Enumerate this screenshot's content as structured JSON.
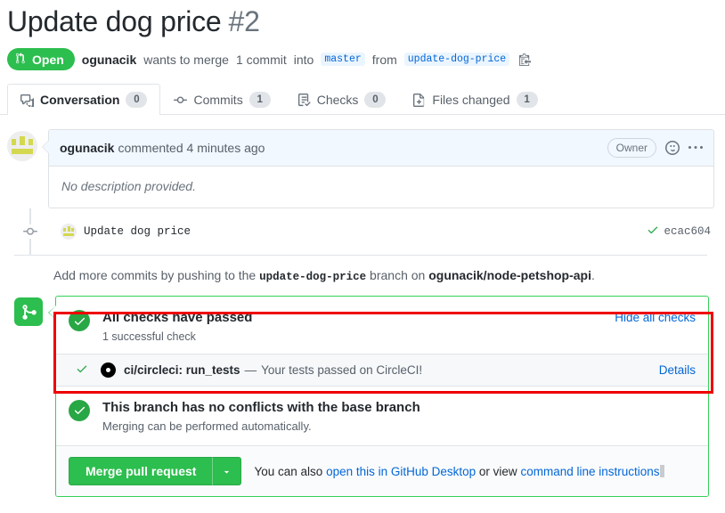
{
  "header": {
    "title": "Update dog price",
    "number": "#2",
    "state_badge": {
      "label": "Open",
      "icon": "pull-request-icon",
      "color": "#2cbe4e"
    },
    "author": "ogunacik",
    "merge_text_1": "wants to merge",
    "commit_count_text": "1 commit",
    "merge_text_2": "into",
    "base_branch": "master",
    "merge_text_3": "from",
    "head_branch": "update-dog-price",
    "copy_icon": "clipboard-copy-icon"
  },
  "tabs": [
    {
      "label": "Conversation",
      "count": "0",
      "icon": "comment-discussion-icon",
      "active": true
    },
    {
      "label": "Commits",
      "count": "1",
      "icon": "git-commit-icon",
      "active": false
    },
    {
      "label": "Checks",
      "count": "0",
      "icon": "checklist-icon",
      "active": false
    },
    {
      "label": "Files changed",
      "count": "1",
      "icon": "file-diff-icon",
      "active": false
    }
  ],
  "comment": {
    "avatar": "user-avatar-identicon",
    "author": "ogunacik",
    "action": "commented",
    "timestamp": "4 minutes ago",
    "owner_badge": "Owner",
    "reaction_icon": "smiley-icon",
    "menu_icon": "kebab-horizontal-icon",
    "body": "No description provided."
  },
  "commit": {
    "dot_icon": "git-commit-icon",
    "avatar": "user-avatar-identicon",
    "message": "Update dog price",
    "status_icon": "check-icon",
    "sha": "ecac604"
  },
  "add_more": {
    "prefix": "Add more commits by pushing to the",
    "branch": "update-dog-price",
    "middle": "branch on",
    "repo": "ogunacik/node-petshop-api",
    "suffix": "."
  },
  "merge": {
    "badge_icon": "git-merge-icon",
    "badge_color": "#2cbe4e",
    "box_border_color": "#34d058",
    "checks": {
      "status_icon": "check-circle-icon",
      "title": "All checks have passed",
      "subtitle": "1 successful check",
      "hide_link": "Hide all checks"
    },
    "check_items": [
      {
        "tick_icon": "check-icon",
        "logo_icon": "circleci-logo-icon",
        "name": "ci/circleci: run_tests",
        "separator": "—",
        "description": "Your tests passed on CircleCI!",
        "details_link": "Details"
      }
    ],
    "conflict": {
      "status_icon": "check-circle-icon",
      "title": "This branch has no conflicts with the base branch",
      "subtitle": "Merging can be performed automatically."
    },
    "actions": {
      "merge_button": "Merge pull request",
      "caret_icon": "triangle-down-icon",
      "note_prefix": "You can also",
      "desktop_link": "open this in GitHub Desktop",
      "note_middle": "or view",
      "cli_link": "command line instructions"
    }
  },
  "annotation": {
    "highlight_color": "#ee0000"
  }
}
